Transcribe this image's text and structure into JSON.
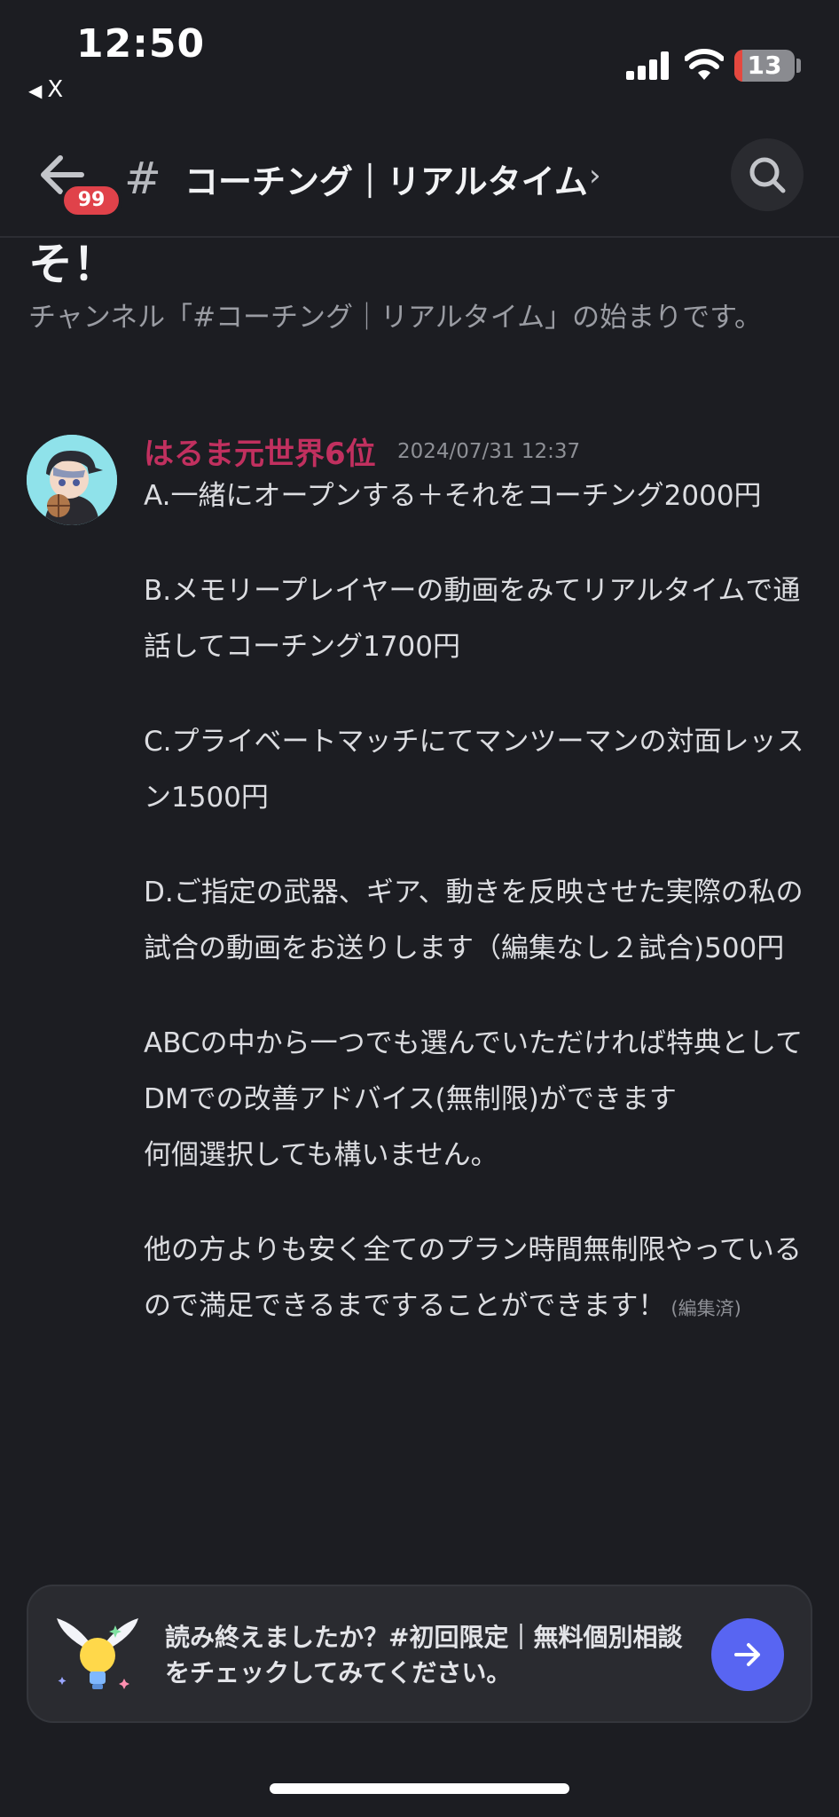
{
  "status_bar": {
    "time": "12:50",
    "back_app_label": "X",
    "battery_level": "13",
    "battery_color": "#e5483f"
  },
  "header": {
    "unread_badge": "99",
    "channel_hash": "#",
    "channel_name": "コーチング｜リアルタイム",
    "chevron": "›"
  },
  "intro": {
    "heading_fragment": "そ！",
    "text": "チャンネル「#コーチング｜リアルタイム」の始まりです。"
  },
  "message": {
    "author": "はるま元世界6位",
    "author_color": "#c1305f",
    "timestamp": "2024/07/31 12:37",
    "paragraphs": [
      "A.一緒にオープンする＋それをコーチング2000円",
      "B.メモリープレイヤーの動画をみてリアルタイムで通話してコーチング1700円",
      "C.プライベートマッチにてマンツーマンの対面レッスン1500円",
      "D.ご指定の武器、ギア、動きを反映させた実際の私の試合の動画をお送りします（編集なし２試合)500円",
      "ABCの中から一つでも選んでいただければ特典としてDMでの改善アドバイス(無制限)ができます",
      "何個選択しても構いません。",
      "他の方よりも安く全てのプラン時間無制限やっているので満足できるまですることができます！"
    ],
    "edited_label": "(編集済)"
  },
  "next_card": {
    "text": "読み終えましたか？#初回限定｜無料個別相談 をチェックしてみてください。",
    "accent": "#5865f2"
  }
}
